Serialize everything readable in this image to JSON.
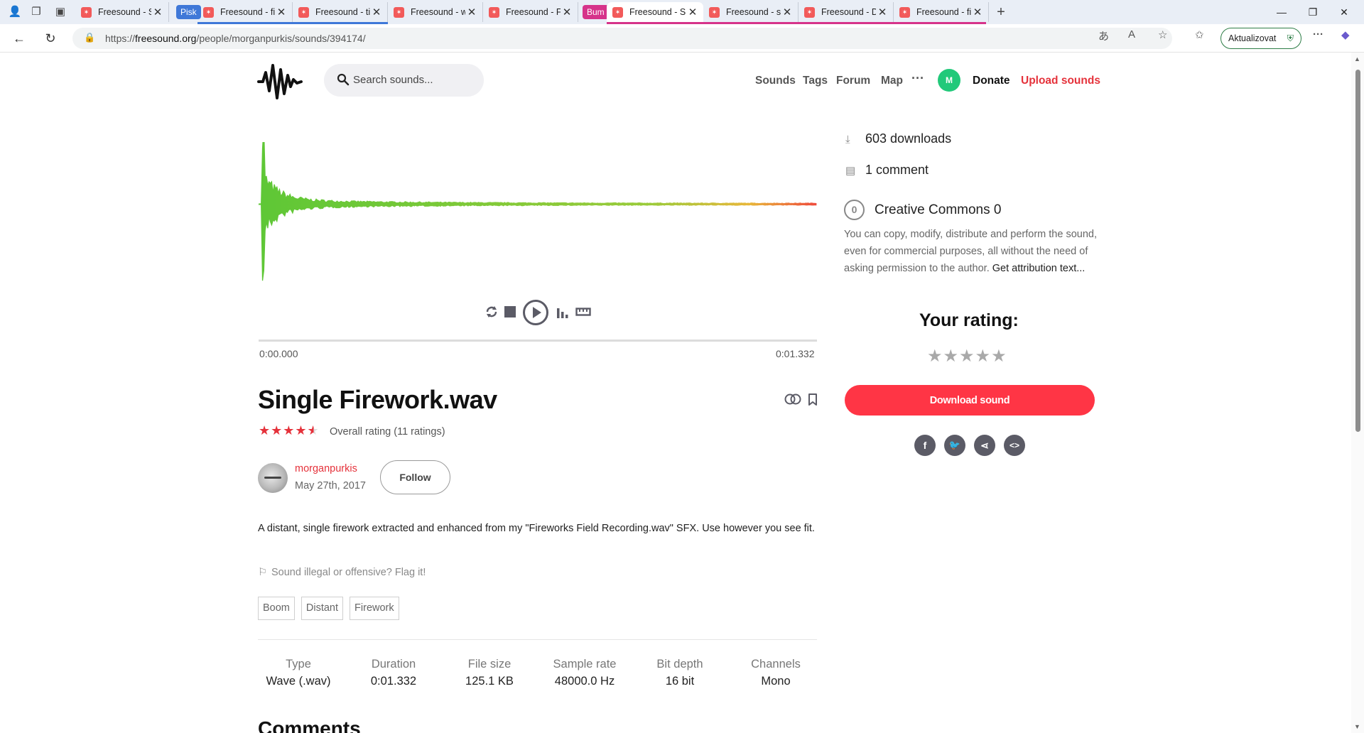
{
  "browser": {
    "tabs": [
      {
        "label": "Freesound - Search"
      },
      {
        "label": "Freesound - firewo"
      },
      {
        "label": "Freesound - tiny_ro"
      },
      {
        "label": "Freesound - whistli"
      },
      {
        "label": "Freesound - Firewo"
      },
      {
        "label": "Freesound - Single"
      },
      {
        "label": "Freesound - single"
      },
      {
        "label": "Freesound - Distan"
      },
      {
        "label": "Freesound - firewo"
      }
    ],
    "group_pisk": "Pisk",
    "group_bum": "Bum",
    "group_pisk_color": "#3f78d8",
    "group_bum_color": "#d6338a",
    "url_prefix": "https://",
    "url_domain": "freesound.org",
    "url_path": "/people/morganpurkis/sounds/394174/",
    "update_label": "Aktualizovat"
  },
  "site": {
    "search_placeholder": "Search sounds...",
    "nav": {
      "sounds": "Sounds",
      "tags": "Tags",
      "forum": "Forum",
      "map": "Map",
      "more": "···"
    },
    "avatar_initial": "M",
    "donate": "Donate",
    "upload": "Upload sounds",
    "accent": "#e5323b"
  },
  "player": {
    "time_start": "0:00.000",
    "time_end": "0:01.332"
  },
  "sound": {
    "title": "Single Firework.wav",
    "rating_text": "Overall rating (11 ratings)",
    "rating_value": 4.5,
    "username": "morganpurkis",
    "date": "May 27th, 2017",
    "follow_label": "Follow",
    "description": "A distant, single firework extracted and enhanced from my \"Fireworks Field Recording.wav\" SFX. Use however you see fit.",
    "flag_text": "Sound illegal or offensive? Flag it!",
    "tags": [
      "Boom",
      "Distant",
      "Firework"
    ],
    "meta": [
      {
        "label": "Type",
        "value": "Wave (.wav)"
      },
      {
        "label": "Duration",
        "value": "0:01.332"
      },
      {
        "label": "File size",
        "value": "125.1 KB"
      },
      {
        "label": "Sample rate",
        "value": "48000.0 Hz"
      },
      {
        "label": "Bit depth",
        "value": "16 bit"
      },
      {
        "label": "Channels",
        "value": "Mono"
      }
    ],
    "comments_heading": "Comments"
  },
  "sidebar": {
    "downloads": "603 downloads",
    "comments": "1 comment",
    "license_icon": "0",
    "license_title": "Creative Commons 0",
    "license_text": "You can copy, modify, distribute and perform the sound, even for commercial purposes, all without the need of asking permission to the author.",
    "attribution_link": "Get attribution text...",
    "your_rating": "Your rating:",
    "download_label": "Download sound",
    "download_color": "#ff3545"
  }
}
